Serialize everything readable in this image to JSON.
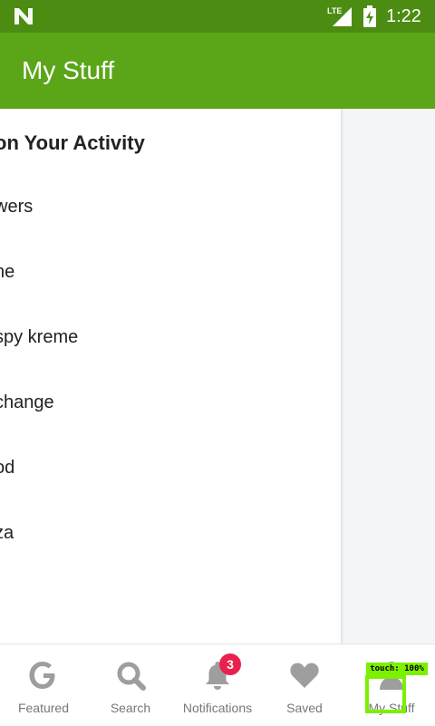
{
  "status_bar": {
    "network_type": "LTE",
    "time": "1:22",
    "icons": [
      "notification-n-icon",
      "lte-signal-icon",
      "battery-charging-icon"
    ],
    "background": "#4c8c12"
  },
  "app_bar": {
    "title": "My Stuff",
    "background": "#5ba518"
  },
  "panel": {
    "section_title": "on Your Activity",
    "items": [
      "wers",
      "ne",
      "spy kreme",
      "change",
      "od",
      "za"
    ]
  },
  "bottom_nav": {
    "tabs": [
      {
        "label": "Featured",
        "icon": "google-g-icon"
      },
      {
        "label": "Search",
        "icon": "search-icon"
      },
      {
        "label": "Notifications",
        "icon": "bell-icon",
        "badge": "3"
      },
      {
        "label": "Saved",
        "icon": "heart-icon"
      },
      {
        "label": "My Stuff",
        "icon": "person-icon"
      }
    ],
    "badge_color": "#e8214f",
    "icon_color": "#9e9e9e"
  },
  "touch_overlay": {
    "label": "touch: 100%",
    "color": "#7cf000"
  }
}
